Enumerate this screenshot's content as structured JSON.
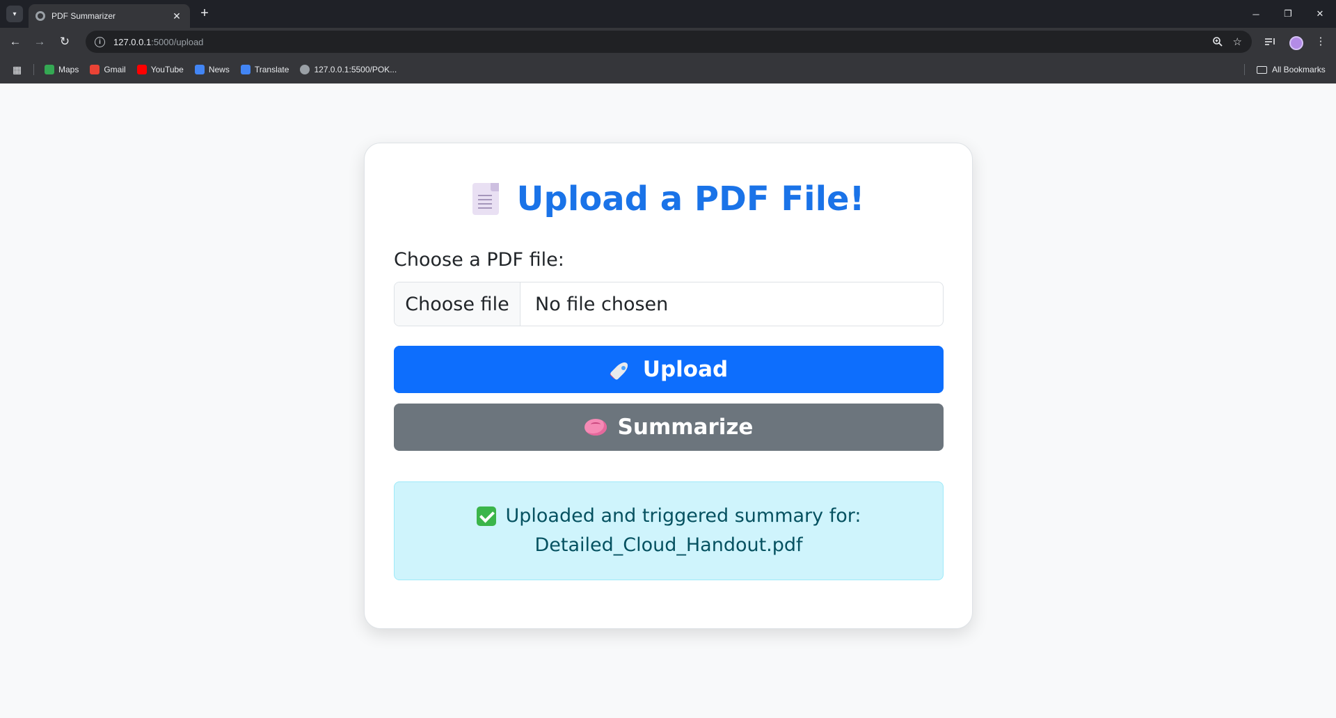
{
  "browser": {
    "tab_title": "PDF Summarizer",
    "tab_close": "✕",
    "new_tab": "+",
    "url_host": "127.0.0.1",
    "url_path": ":5000/upload",
    "window_controls": {
      "minimize": "─",
      "restore": "❐",
      "close": "✕"
    },
    "nav": {
      "back": "←",
      "forward": "→",
      "reload": "↻"
    },
    "bookmarks": [
      {
        "label": "Maps",
        "icon": "maps-icon",
        "color": "#34a853"
      },
      {
        "label": "Gmail",
        "icon": "gmail-icon",
        "color": "#ea4335"
      },
      {
        "label": "YouTube",
        "icon": "youtube-icon",
        "color": "#ff0000"
      },
      {
        "label": "News",
        "icon": "news-icon",
        "color": "#4285f4"
      },
      {
        "label": "Translate",
        "icon": "translate-icon",
        "color": "#4285f4"
      },
      {
        "label": "127.0.0.1:5500/POK...",
        "icon": "globe-icon",
        "color": "#9aa0a6"
      }
    ],
    "all_bookmarks": "All Bookmarks"
  },
  "page": {
    "heading": "Upload a PDF File!",
    "heading_icon": "document-icon",
    "file_label": "Choose a PDF file:",
    "choose_file_button": "Choose file",
    "no_file_text": "No file chosen",
    "upload_button": "Upload",
    "upload_icon": "rocket-icon",
    "summarize_button": "Summarize",
    "summarize_icon": "brain-icon",
    "alert_line1": "Uploaded and triggered summary for:",
    "alert_line2": "Detailed_Cloud_Handout.pdf",
    "alert_icon": "check-mark-icon"
  },
  "colors": {
    "primary": "#0d6efd",
    "secondary": "#6c757d",
    "heading": "#1a73e8",
    "alert_bg": "#cff4fc",
    "alert_text": "#055160"
  }
}
